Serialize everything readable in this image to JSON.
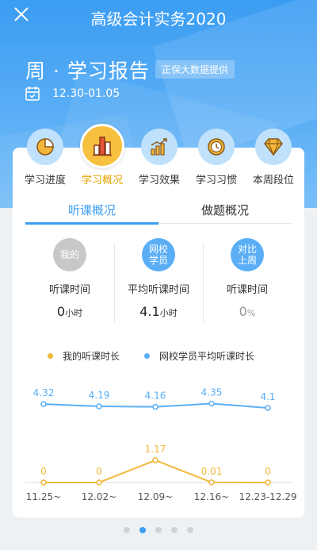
{
  "app": {
    "title": "高级会计实务2020",
    "close_icon": "close-icon"
  },
  "report": {
    "title": "周 · 学习报告",
    "provider": "正保大数据提供",
    "date_range": "12.30-01.05",
    "calendar_icon": "calendar-icon"
  },
  "tabs": [
    {
      "label": "学习进度",
      "icon": "pie-chart-icon",
      "active": false
    },
    {
      "label": "学习概况",
      "icon": "bar-chart-icon",
      "active": true
    },
    {
      "label": "学习效果",
      "icon": "growth-chart-icon",
      "active": false
    },
    {
      "label": "学习习惯",
      "icon": "clock-icon",
      "active": false
    },
    {
      "label": "本周段位",
      "icon": "diamond-icon",
      "active": false
    }
  ],
  "subtabs": [
    {
      "label": "听课概况",
      "active": true
    },
    {
      "label": "做题概况",
      "active": false
    }
  ],
  "stats": [
    {
      "badge": "我的",
      "label": "听课时间",
      "value": "0",
      "unit": "小时",
      "badge_color": "#c8c8c8",
      "value_color": "#222222"
    },
    {
      "badge": "网校\n学员",
      "label": "平均听课时间",
      "value": "4.1",
      "unit": "小时",
      "badge_color": "#5aaef6",
      "value_color": "#222222"
    },
    {
      "badge": "对比\n上周",
      "label": "听课时间",
      "value": "0",
      "unit": "%",
      "badge_color": "#5aaef6",
      "value_color": "#999999"
    }
  ],
  "legend": {
    "mine": "我的听课时长",
    "average": "网校学员平均听课时长"
  },
  "colors": {
    "accent": "#3b9df2",
    "mine": "#f0b73a",
    "average": "#5aaef6"
  },
  "chart_data": {
    "type": "line",
    "categories": [
      "11.25~",
      "12.02~",
      "12.09~",
      "12.16~",
      "12.23-12.29"
    ],
    "series": [
      {
        "name": "网校学员平均听课时长",
        "values": [
          4.32,
          4.19,
          4.16,
          4.35,
          4.1
        ],
        "labels": [
          "4.32",
          "4.19",
          "4.16",
          "4.35",
          "4.1"
        ]
      },
      {
        "name": "我的听课时长",
        "values": [
          0,
          0,
          1.17,
          0.01,
          0
        ],
        "labels": [
          "0",
          "0",
          "1.17",
          "0.01",
          "0"
        ]
      }
    ]
  },
  "pager": {
    "count": 5,
    "active_index": 1
  }
}
